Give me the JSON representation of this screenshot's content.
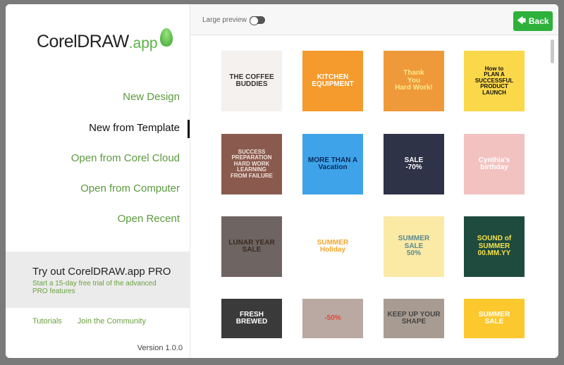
{
  "sidebar": {
    "logo": {
      "main": "CorelDRAW",
      "suffix": ".app"
    },
    "nav": [
      {
        "label": "New Design"
      },
      {
        "label": "New from Template",
        "active": true
      },
      {
        "label": "Open from Corel Cloud"
      },
      {
        "label": "Open from Computer"
      },
      {
        "label": "Open Recent"
      }
    ],
    "promo": {
      "title": "Try out CorelDRAW.app PRO",
      "subtitle": "Start a 15-day free trial of the advanced PRO features"
    },
    "links": [
      {
        "label": "Tutorials"
      },
      {
        "label": "Join the Community"
      }
    ],
    "version": "Version 1.0.0"
  },
  "topbar": {
    "large_preview_label": "Large preview",
    "large_preview_on": false,
    "back_label": "Back",
    "back_icon": "arrow-left-icon"
  },
  "colors": {
    "accent": "#2db13a",
    "link": "#5b9a3e"
  },
  "templates": [
    {
      "lines": [
        "THE COFFEE BUDDIES"
      ],
      "bg": "#f4f1ee",
      "fg": "#333"
    },
    {
      "lines": [
        "KITCHEN",
        "EQUIPMENT"
      ],
      "bg": "#f59a2c",
      "fg": "#fff"
    },
    {
      "lines": [
        "Thank",
        "You",
        "Hard Work!"
      ],
      "bg": "#ef9a3a",
      "fg": "#fbe88a"
    },
    {
      "lines": [
        "How to",
        "PLAN A",
        "SUCCESSFUL",
        "PRODUCT",
        "LAUNCH"
      ],
      "bg": "#fbd84a",
      "fg": "#111"
    },
    {
      "lines": [
        "SUCCESS",
        "PREPARATION",
        "HARD WORK",
        "LEARNING",
        "FROM FAILURE"
      ],
      "bg": "#8a5a4e",
      "fg": "#f1e4dc"
    },
    {
      "lines": [
        "MORE THAN A",
        "Vacation"
      ],
      "bg": "#3ea3e8",
      "fg": "#0c2a5a"
    },
    {
      "lines": [
        "SALE",
        "-70%"
      ],
      "bg": "#2f3347",
      "fg": "#fff"
    },
    {
      "lines": [
        "Cynthia's",
        "birthday"
      ],
      "bg": "#f2c2c0",
      "fg": "#fff"
    },
    {
      "lines": [
        "LUNAR YEAR",
        "SALE"
      ],
      "bg": "#6e6462",
      "fg": "#3a2a20"
    },
    {
      "lines": [
        "SUMMER",
        "Holiday"
      ],
      "bg": "#ffffff",
      "fg": "#f2a62c"
    },
    {
      "lines": [
        "SUMMER",
        "SALE",
        "50%"
      ],
      "bg": "#fbe9a6",
      "fg": "#5a8a8a"
    },
    {
      "lines": [
        "SOUND of",
        "SUMMER",
        "00.MM.YY"
      ],
      "bg": "#1f4a3e",
      "fg": "#f6e24a"
    },
    {
      "lines": [
        "FRESH",
        "BREWED"
      ],
      "bg": "#3a3a3a",
      "fg": "#fff"
    },
    {
      "lines": [
        "-50%"
      ],
      "bg": "#b9a9a2",
      "fg": "#e04a3a"
    },
    {
      "lines": [
        "KEEP UP YOUR SHAPE"
      ],
      "bg": "#a89c92",
      "fg": "#444"
    },
    {
      "lines": [
        "SUMMER",
        "SALE"
      ],
      "bg": "#fbc82e",
      "fg": "#fff"
    }
  ]
}
